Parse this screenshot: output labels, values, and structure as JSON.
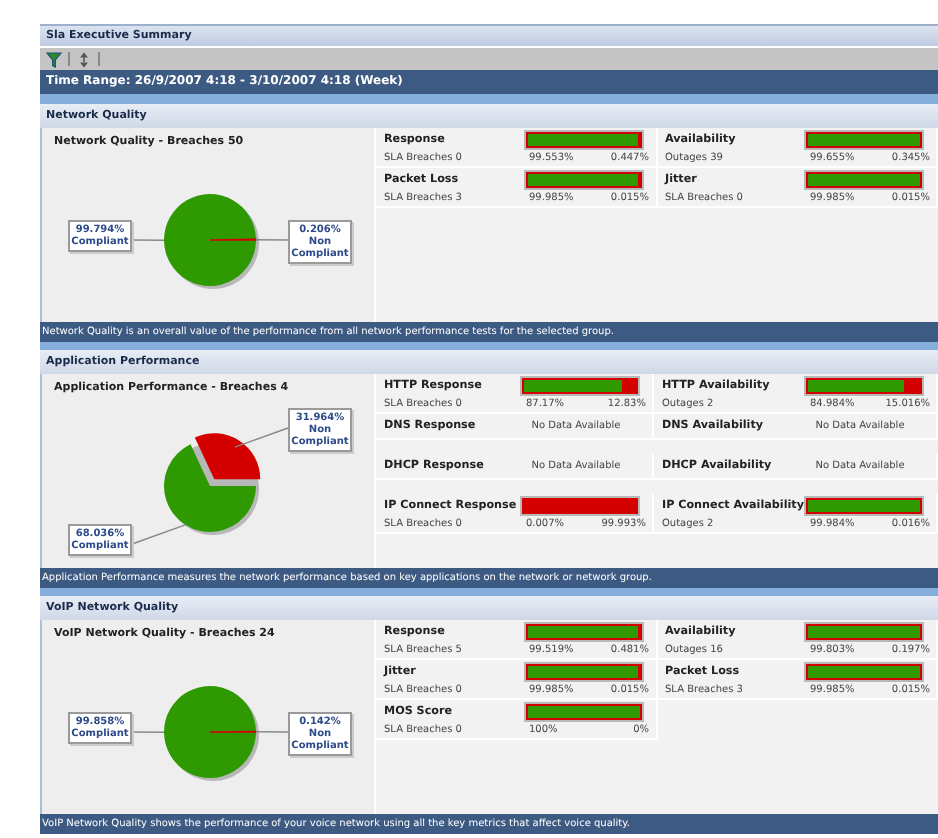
{
  "window": {
    "title": "Sla Executive Summary"
  },
  "toolbar": {
    "buttons": [
      {
        "kind": "filter"
      },
      {
        "kind": "sort"
      }
    ]
  },
  "time_range": "Time Range: 26/9/2007 4:18 - 3/10/2007 4:18 (Week)",
  "sections": [
    {
      "title": "Network Quality",
      "chart_data": {
        "type": "pie",
        "title": "Network Quality - Breaches 50",
        "categories": [
          "Compliant",
          "Non Compliant"
        ],
        "values": [
          99.794,
          0.206
        ],
        "colors": [
          "#2e9900",
          "#d40000"
        ],
        "value_labels": [
          "99.794%",
          "0.206%"
        ]
      },
      "metrics": [
        {
          "kind": "bar",
          "name": "Response",
          "level": 0.99553,
          "detail": "SLA Breaches 0",
          "compliant": "99.553%",
          "non_compliant": "0.447%"
        },
        {
          "kind": "bar",
          "name": "Availability",
          "level": 0.99655,
          "detail": "Outages 39",
          "compliant": "99.655%",
          "non_compliant": "0.345%"
        },
        {
          "kind": "bar",
          "name": "Packet Loss",
          "level": 0.99985,
          "detail": "SLA Breaches 3",
          "compliant": "99.985%",
          "non_compliant": "0.015%"
        },
        {
          "kind": "bar",
          "name": "Jitter",
          "level": 0.99985,
          "detail": "SLA Breaches 0",
          "compliant": "99.985%",
          "non_compliant": "0.015%"
        }
      ],
      "description": "Network Quality is an overall value of the performance from all network performance tests for the selected group."
    },
    {
      "title": "Application Performance",
      "chart_data": {
        "type": "pie",
        "title": "Application Performance - Breaches 4",
        "categories": [
          "Compliant",
          "Non Compliant"
        ],
        "values": [
          68.036,
          31.964
        ],
        "colors": [
          "#2e9900",
          "#d40000"
        ],
        "value_labels": [
          "68.036%",
          "31.964%"
        ]
      },
      "metrics": [
        {
          "kind": "bar",
          "name": "HTTP Response",
          "level": 0.8717,
          "detail": "SLA Breaches 0",
          "compliant": "87.17%",
          "non_compliant": "12.83%"
        },
        {
          "kind": "bar",
          "name": "HTTP Availability",
          "level": 0.84984,
          "detail": "Outages 2",
          "compliant": "84.984%",
          "non_compliant": "15.016%"
        },
        {
          "kind": "nodata",
          "name": "DNS Response",
          "note": "No Data Available"
        },
        {
          "kind": "nodata",
          "name": "DNS Availability",
          "note": "No Data Available"
        },
        {
          "kind": "nodata",
          "name": "DHCP Response",
          "note": "No Data Available"
        },
        {
          "kind": "nodata",
          "name": "DHCP Availability",
          "note": "No Data Available"
        },
        {
          "kind": "bar",
          "name": "IP Connect Response",
          "level": 7e-05,
          "detail": "SLA Breaches 0",
          "compliant": "0.007%",
          "non_compliant": "99.993%"
        },
        {
          "kind": "bar",
          "name": "IP Connect Availability",
          "level": 0.99984,
          "detail": "Outages 2",
          "compliant": "99.984%",
          "non_compliant": "0.016%"
        }
      ],
      "description": "Application Performance measures the network performance based on key applications on the network or network group."
    },
    {
      "title": "VoIP Network Quality",
      "chart_data": {
        "type": "pie",
        "title": "VoIP Network Quality - Breaches 24",
        "categories": [
          "Compliant",
          "Non Compliant"
        ],
        "values": [
          99.858,
          0.142
        ],
        "colors": [
          "#2e9900",
          "#d40000"
        ],
        "value_labels": [
          "99.858%",
          "0.142%"
        ]
      },
      "metrics": [
        {
          "kind": "bar",
          "name": "Response",
          "level": 0.99519,
          "detail": "SLA Breaches 5",
          "compliant": "99.519%",
          "non_compliant": "0.481%"
        },
        {
          "kind": "bar",
          "name": "Availability",
          "level": 0.99803,
          "detail": "Outages 16",
          "compliant": "99.803%",
          "non_compliant": "0.197%"
        },
        {
          "kind": "bar",
          "name": "Jitter",
          "level": 0.99985,
          "detail": "SLA Breaches 0",
          "compliant": "99.985%",
          "non_compliant": "0.015%"
        },
        {
          "kind": "bar",
          "name": "Packet Loss",
          "level": 0.99985,
          "detail": "SLA Breaches 3",
          "compliant": "99.985%",
          "non_compliant": "0.015%"
        },
        {
          "kind": "bar",
          "name": "MOS Score",
          "level": 1,
          "detail": "SLA Breaches 0",
          "compliant": "100%",
          "non_compliant": "0%"
        }
      ],
      "description": "VoIP Network Quality shows the performance of your voice network using all the key metrics that affect voice quality."
    }
  ]
}
